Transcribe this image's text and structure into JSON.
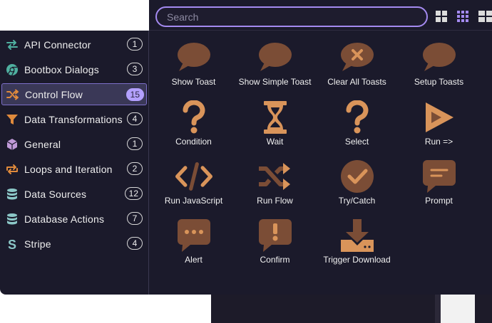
{
  "search": {
    "placeholder": "Search"
  },
  "colors": {
    "accent": "#a48af0",
    "icon": "#d9945a",
    "icon_dark": "#7b4d36",
    "badge_active": "#b3a0ff"
  },
  "sidebar": {
    "items": [
      {
        "label": "API Connector",
        "count": "1",
        "icon": "arrows-left-right-icon",
        "active": false
      },
      {
        "label": "Bootbox Dialogs",
        "count": "3",
        "icon": "chrome-icon",
        "active": false
      },
      {
        "label": "Control Flow",
        "count": "15",
        "icon": "shuffle-icon",
        "active": true
      },
      {
        "label": "Data Transformations",
        "count": "4",
        "icon": "filter-icon",
        "active": false
      },
      {
        "label": "General",
        "count": "1",
        "icon": "cube-icon",
        "active": false
      },
      {
        "label": "Loops and Iteration",
        "count": "2",
        "icon": "loop-arrows-icon",
        "active": false
      },
      {
        "label": "Data Sources",
        "count": "12",
        "icon": "database-icon",
        "active": false
      },
      {
        "label": "Database Actions",
        "count": "7",
        "icon": "database-icon",
        "active": false
      },
      {
        "label": "Stripe",
        "count": "4",
        "icon": "stripe-s-icon",
        "active": false
      }
    ]
  },
  "actions": [
    {
      "label": "Show Toast",
      "icon": "speech-bubble-icon"
    },
    {
      "label": "Show Simple Toast",
      "icon": "speech-bubble-icon"
    },
    {
      "label": "Clear All Toasts",
      "icon": "speech-bubble-x-icon"
    },
    {
      "label": "Setup Toasts",
      "icon": "speech-bubble-icon"
    },
    {
      "label": "Condition",
      "icon": "question-mark-icon"
    },
    {
      "label": "Wait",
      "icon": "hourglass-icon"
    },
    {
      "label": "Select",
      "icon": "question-mark-icon"
    },
    {
      "label": "Run =>",
      "icon": "play-icon"
    },
    {
      "label": "Run JavaScript",
      "icon": "code-icon"
    },
    {
      "label": "Run Flow",
      "icon": "shuffle-icon"
    },
    {
      "label": "Try/Catch",
      "icon": "check-circle-icon"
    },
    {
      "label": "Prompt",
      "icon": "message-lines-icon"
    },
    {
      "label": "Alert",
      "icon": "message-dots-icon"
    },
    {
      "label": "Confirm",
      "icon": "message-exclamation-icon"
    },
    {
      "label": "Trigger Download",
      "icon": "download-icon"
    }
  ]
}
